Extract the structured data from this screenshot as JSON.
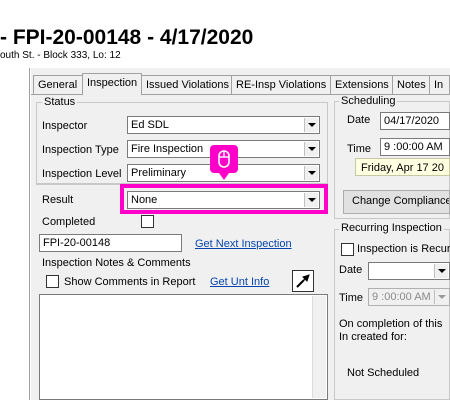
{
  "header": {
    "title": "- FPI-20-00148 - 4/17/2020",
    "subtitle": "outh St. - Block 333, Lo: 12"
  },
  "tabs": [
    {
      "label": "General"
    },
    {
      "label": "Inspection"
    },
    {
      "label": "Issued Violations"
    },
    {
      "label": "RE-Insp Violations"
    },
    {
      "label": "Extensions"
    },
    {
      "label": "Notes"
    },
    {
      "label": "In"
    }
  ],
  "status": {
    "legend": "Status",
    "inspector_label": "Inspector",
    "inspector_value": "Ed SDL",
    "type_label": "Inspection Type",
    "type_value": "Fire Inspection",
    "level_label": "Inspection Level",
    "level_value": "Preliminary"
  },
  "result": {
    "label": "Result",
    "value": "None",
    "completed_label": "Completed",
    "inspection_number": "FPI-20-00148",
    "next_inspection_link": "Get Next Inspection",
    "notes_label": "Inspection Notes & Comments",
    "show_comments_label": "Show Comments in Report",
    "unit_info_link": "Get Unt Info"
  },
  "scheduling": {
    "legend": "Scheduling",
    "date_label": "Date",
    "date_value": "04/17/2020",
    "time_label": "Time",
    "time_value": "9 :00:00 AM",
    "day_display": "Friday, Apr 17 20",
    "change_button": "Change Compliance"
  },
  "recurring": {
    "legend": "Recurring Inspection",
    "checkbox_label": "Inspection is Recurr",
    "date_label": "Date",
    "date_value": "",
    "time_label": "Time",
    "time_value": "9 :00:00 AM",
    "completion_note": "On completion of this In created for:",
    "schedule_status": "Not Scheduled"
  },
  "icons": {
    "mouse": "mouse-icon",
    "edit": "edit-pointer-icon"
  },
  "colors": {
    "highlight": "#ff00c8",
    "link": "#0645ad",
    "panel": "#f0f0f0"
  }
}
